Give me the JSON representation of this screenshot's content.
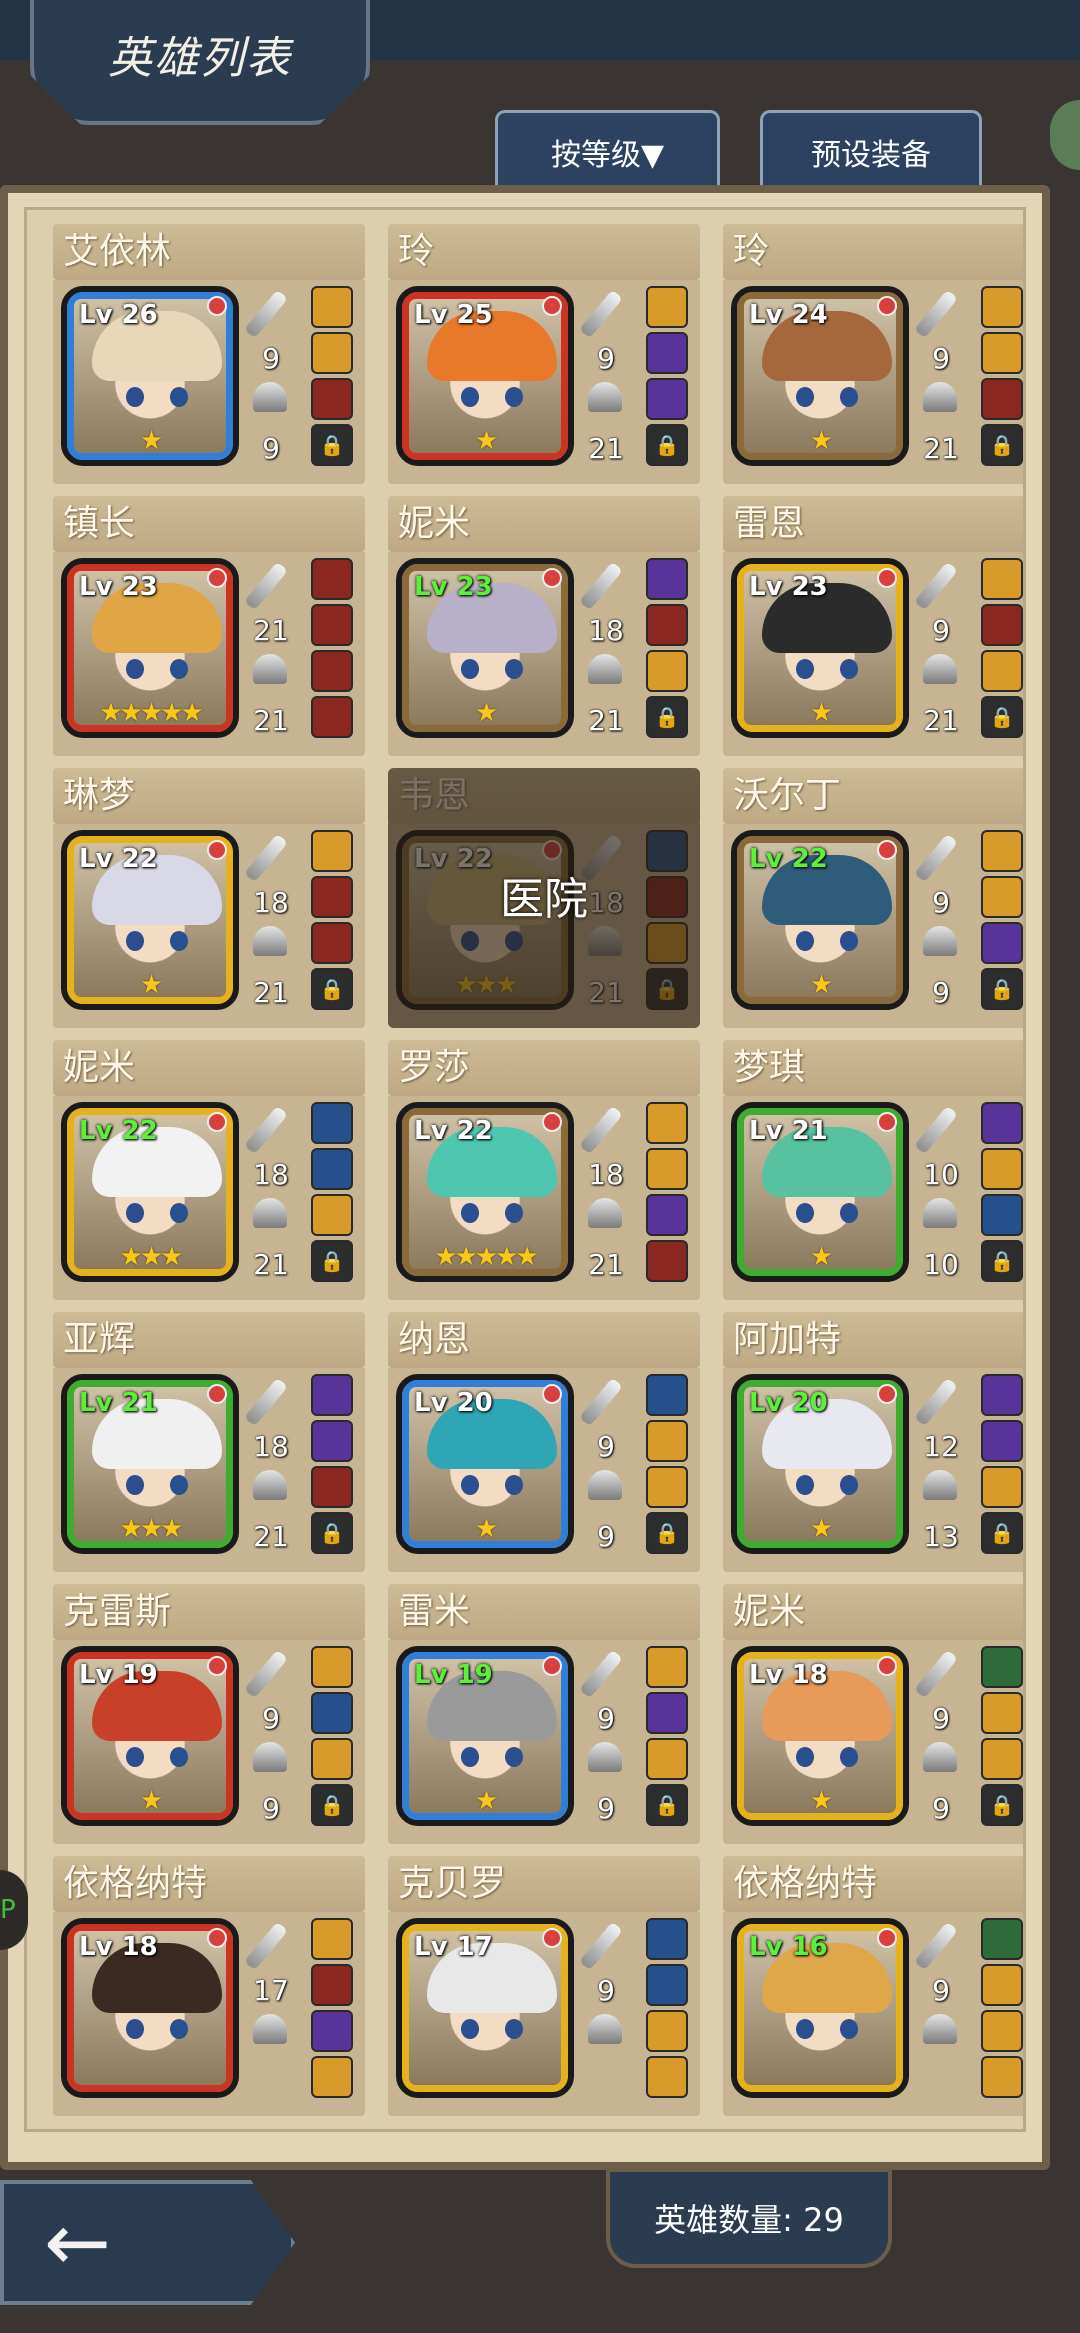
{
  "header": {
    "title": "英雄列表",
    "sort_button": "按等级▼",
    "preset_button": "预设装备"
  },
  "footer": {
    "hero_count": "英雄数量: 29",
    "back_icon": "back-arrow-icon"
  },
  "side_tab_label": "P",
  "heroes": [
    {
      "name": "艾依林",
      "level": "Lv 26",
      "frame": "blue",
      "stars": 1,
      "atk": "9",
      "def": "9",
      "level_green": false,
      "equip": [
        "yellow",
        "yellow",
        "red",
        "lock"
      ]
    },
    {
      "name": "玲",
      "level": "Lv 25",
      "frame": "red",
      "stars": 1,
      "atk": "9",
      "def": "21",
      "level_green": false,
      "equip": [
        "yellow",
        "purple",
        "purple",
        "lock"
      ]
    },
    {
      "name": "玲",
      "level": "Lv 24",
      "frame": "bronze",
      "stars": 1,
      "atk": "9",
      "def": "21",
      "level_green": false,
      "equip": [
        "yellow",
        "yellow",
        "red",
        "lock"
      ]
    },
    {
      "name": "镇长",
      "level": "Lv 23",
      "frame": "red",
      "stars": 5,
      "atk": "21",
      "def": "21",
      "level_green": false,
      "equip": [
        "red",
        "red",
        "red",
        "red"
      ]
    },
    {
      "name": "妮米",
      "level": "Lv 23",
      "frame": "bronze",
      "stars": 1,
      "atk": "18",
      "def": "21",
      "level_green": true,
      "equip": [
        "purple",
        "red",
        "yellow",
        "lock"
      ]
    },
    {
      "name": "雷恩",
      "level": "Lv 23",
      "frame": "gold",
      "stars": 1,
      "atk": "9",
      "def": "21",
      "level_green": false,
      "equip": [
        "yellow",
        "red",
        "yellow",
        "lock"
      ]
    },
    {
      "name": "琳梦",
      "level": "Lv 22",
      "frame": "gold",
      "stars": 1,
      "atk": "18",
      "def": "21",
      "level_green": false,
      "equip": [
        "yellow",
        "red",
        "red",
        "lock"
      ]
    },
    {
      "name": "韦恩",
      "level": "Lv 22",
      "frame": "bronze",
      "stars": 3,
      "atk": "18",
      "def": "21",
      "level_green": false,
      "hospital": "医院",
      "equip": [
        "blue",
        "red",
        "yellow",
        "lock"
      ]
    },
    {
      "name": "沃尔丁",
      "level": "Lv 22",
      "frame": "bronze",
      "stars": 1,
      "atk": "9",
      "def": "9",
      "level_green": true,
      "equip": [
        "yellow",
        "yellow",
        "purple",
        "lock"
      ]
    },
    {
      "name": "妮米",
      "level": "Lv 22",
      "frame": "gold",
      "stars": 3,
      "atk": "18",
      "def": "21",
      "level_green": true,
      "equip": [
        "blue",
        "blue",
        "yellow",
        "lock"
      ]
    },
    {
      "name": "罗莎",
      "level": "Lv 22",
      "frame": "bronze",
      "stars": 5,
      "atk": "18",
      "def": "21",
      "level_green": false,
      "equip": [
        "yellow",
        "yellow",
        "purple",
        "red"
      ]
    },
    {
      "name": "梦琪",
      "level": "Lv 21",
      "frame": "green",
      "stars": 1,
      "atk": "10",
      "def": "10",
      "level_green": false,
      "equip": [
        "purple",
        "yellow",
        "blue",
        "lock"
      ]
    },
    {
      "name": "亚辉",
      "level": "Lv 21",
      "frame": "green",
      "stars": 3,
      "atk": "18",
      "def": "21",
      "level_green": true,
      "equip": [
        "purple",
        "purple",
        "red",
        "lock"
      ]
    },
    {
      "name": "纳恩",
      "level": "Lv 20",
      "frame": "blue",
      "stars": 1,
      "atk": "9",
      "def": "9",
      "level_green": false,
      "equip": [
        "blue",
        "yellow",
        "yellow",
        "lock"
      ]
    },
    {
      "name": "阿加特",
      "level": "Lv 20",
      "frame": "green",
      "stars": 1,
      "atk": "12",
      "def": "13",
      "level_green": true,
      "equip": [
        "purple",
        "purple",
        "yellow",
        "lock"
      ]
    },
    {
      "name": "克雷斯",
      "level": "Lv 19",
      "frame": "red",
      "stars": 1,
      "atk": "9",
      "def": "9",
      "level_green": false,
      "equip": [
        "yellow",
        "blue",
        "yellow",
        "lock"
      ]
    },
    {
      "name": "雷米",
      "level": "Lv 19",
      "frame": "blue",
      "stars": 1,
      "atk": "9",
      "def": "9",
      "level_green": true,
      "equip": [
        "yellow",
        "purple",
        "yellow",
        "lock"
      ]
    },
    {
      "name": "妮米",
      "level": "Lv 18",
      "frame": "gold",
      "stars": 1,
      "atk": "9",
      "def": "9",
      "level_green": false,
      "equip": [
        "green",
        "yellow",
        "yellow",
        "lock"
      ]
    },
    {
      "name": "依格纳特",
      "level": "Lv 18",
      "frame": "red",
      "stars": 0,
      "atk": "17",
      "def": "",
      "level_green": false,
      "equip": [
        "yellow",
        "red",
        "purple",
        "yellow"
      ]
    },
    {
      "name": "克贝罗",
      "level": "Lv 17",
      "frame": "gold",
      "stars": 0,
      "atk": "9",
      "def": "",
      "level_green": false,
      "equip": [
        "blue",
        "blue",
        "yellow",
        "yellow"
      ]
    },
    {
      "name": "依格纳特",
      "level": "Lv 16",
      "frame": "gold",
      "stars": 0,
      "atk": "9",
      "def": "",
      "level_green": true,
      "equip": [
        "green",
        "yellow",
        "yellow",
        "yellow"
      ]
    }
  ],
  "colors": {
    "panel_bg": "#e3d5b6",
    "card_header": "#bea984",
    "level_green": "#5cf03a",
    "star": "#f6c81a"
  }
}
